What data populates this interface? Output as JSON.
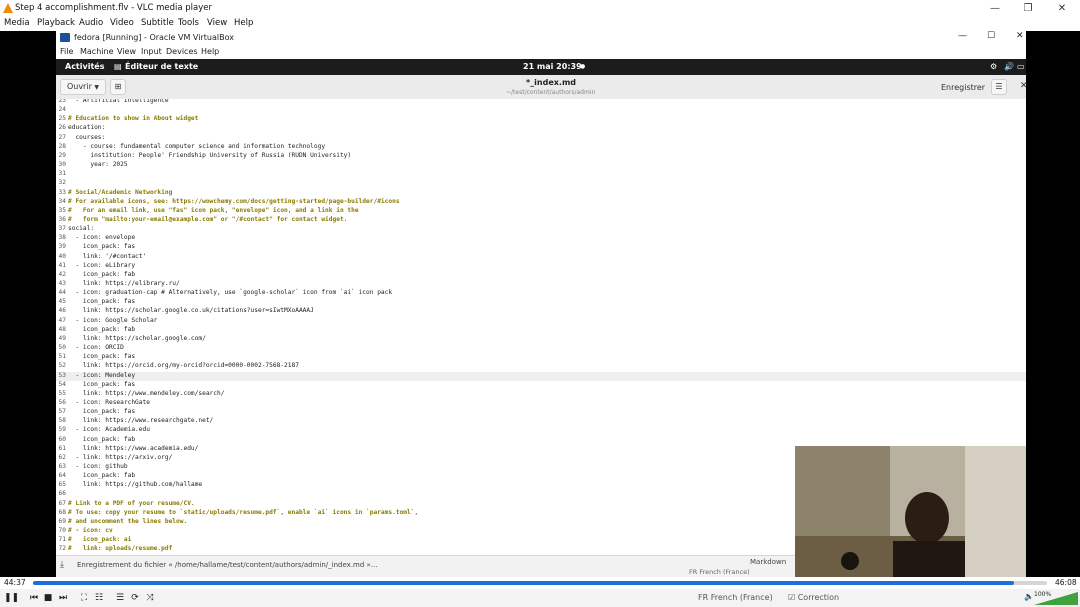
{
  "vlc": {
    "title": "Step 4 accomplishment.flv - VLC media player",
    "menu": [
      "Media",
      "Playback",
      "Audio",
      "Video",
      "Subtitle",
      "Tools",
      "View",
      "Help"
    ],
    "time_elapsed": "44:37",
    "time_total": "46:08",
    "progress": 0.967,
    "volume_label": "100%"
  },
  "vm": {
    "title": "fedora [Running] - Oracle VM VirtualBox",
    "menu": [
      "File",
      "Machine",
      "View",
      "Input",
      "Devices",
      "Help"
    ]
  },
  "gnome": {
    "activities": "Activités",
    "app": "Éditeur de texte",
    "clock": "21 mai  20:39"
  },
  "editor": {
    "open_label": "Ouvrir",
    "doc_title": "*_index.md",
    "doc_path": "~/test/content/authors/admin",
    "save_label": "Enregistrer",
    "current_line": "53",
    "lines": [
      {
        "n": "23",
        "t": "  - Artificial Intelligence"
      },
      {
        "n": "24",
        "t": ""
      },
      {
        "n": "25",
        "t": "# Education to show in About widget"
      },
      {
        "n": "26",
        "t": "education:"
      },
      {
        "n": "27",
        "t": "  courses:"
      },
      {
        "n": "28",
        "t": "    - course: fundamental computer science and information technology"
      },
      {
        "n": "29",
        "t": "      institution: People' Friendship University of Russia (RUDN University)"
      },
      {
        "n": "30",
        "t": "      year: 2025"
      },
      {
        "n": "31",
        "t": ""
      },
      {
        "n": "32",
        "t": ""
      },
      {
        "n": "33",
        "t": "# Social/Academic Networking"
      },
      {
        "n": "34",
        "t": "# For available icons, see: https://wowchemy.com/docs/getting-started/page-builder/#icons"
      },
      {
        "n": "35",
        "t": "#   For an email link, use \"fas\" icon pack, \"envelope\" icon, and a link in the"
      },
      {
        "n": "36",
        "t": "#   form \"mailto:your-email@example.com\" or \"/#contact\" for contact widget."
      },
      {
        "n": "37",
        "t": "social:"
      },
      {
        "n": "38",
        "t": "  - icon: envelope"
      },
      {
        "n": "39",
        "t": "    icon_pack: fas"
      },
      {
        "n": "40",
        "t": "    link: '/#contact'"
      },
      {
        "n": "41",
        "t": "  - icon: eLibrary"
      },
      {
        "n": "42",
        "t": "    icon_pack: fab"
      },
      {
        "n": "43",
        "t": "    link: https://elibrary.ru/"
      },
      {
        "n": "44",
        "t": "  - icon: graduation-cap # Alternatively, use `google-scholar` icon from `ai` icon pack"
      },
      {
        "n": "45",
        "t": "    icon_pack: fas"
      },
      {
        "n": "46",
        "t": "    link: https://scholar.google.co.uk/citations?user=sIwtMXoAAAAJ"
      },
      {
        "n": "47",
        "t": "  - icon: Google Scholar"
      },
      {
        "n": "48",
        "t": "    icon_pack: fab"
      },
      {
        "n": "49",
        "t": "    link: https://scholar.google.com/"
      },
      {
        "n": "50",
        "t": "  - icon: ORCID"
      },
      {
        "n": "51",
        "t": "    icon_pack: fas"
      },
      {
        "n": "52",
        "t": "    link: https://orcid.org/my-orcid?orcid=0000-0002-7568-2187"
      },
      {
        "n": "53",
        "t": "  - icon: Mendeley"
      },
      {
        "n": "54",
        "t": "    icon_pack: fas"
      },
      {
        "n": "55",
        "t": "    link: https://www.mendeley.com/search/"
      },
      {
        "n": "56",
        "t": "  - icon: ResearchGate"
      },
      {
        "n": "57",
        "t": "    icon_pack: fas"
      },
      {
        "n": "58",
        "t": "    link: https://www.researchgate.net/"
      },
      {
        "n": "59",
        "t": "  - icon: Academia.edu"
      },
      {
        "n": "60",
        "t": "    icon_pack: fab"
      },
      {
        "n": "61",
        "t": "    link: https://www.academia.edu/"
      },
      {
        "n": "62",
        "t": "  - link: https://arxiv.org/"
      },
      {
        "n": "63",
        "t": "  - icon: github"
      },
      {
        "n": "64",
        "t": "    icon_pack: fab"
      },
      {
        "n": "65",
        "t": "    link: https://github.com/hallame"
      },
      {
        "n": "66",
        "t": ""
      },
      {
        "n": "67",
        "t": "# Link to a PDF of your resume/CV."
      },
      {
        "n": "68",
        "t": "# To use: copy your resume to `static/uploads/resume.pdf`, enable `ai` icons in `params.toml`,"
      },
      {
        "n": "69",
        "t": "# and uncomment the lines below."
      },
      {
        "n": "70",
        "t": "# - icon: cv"
      },
      {
        "n": "71",
        "t": "#   icon_pack: ai"
      },
      {
        "n": "72",
        "t": "#   link: uploads/resume.pdf"
      }
    ],
    "status_message": "Enregistrement du fichier « /home/hallame/test/content/authors/admin/_index.md »...",
    "language": "Markdown",
    "spell_lang": "FR French (France)",
    "correction": "Correction"
  },
  "colors": {
    "comment": "#8a7a00",
    "accent": "#1e6fd9"
  }
}
